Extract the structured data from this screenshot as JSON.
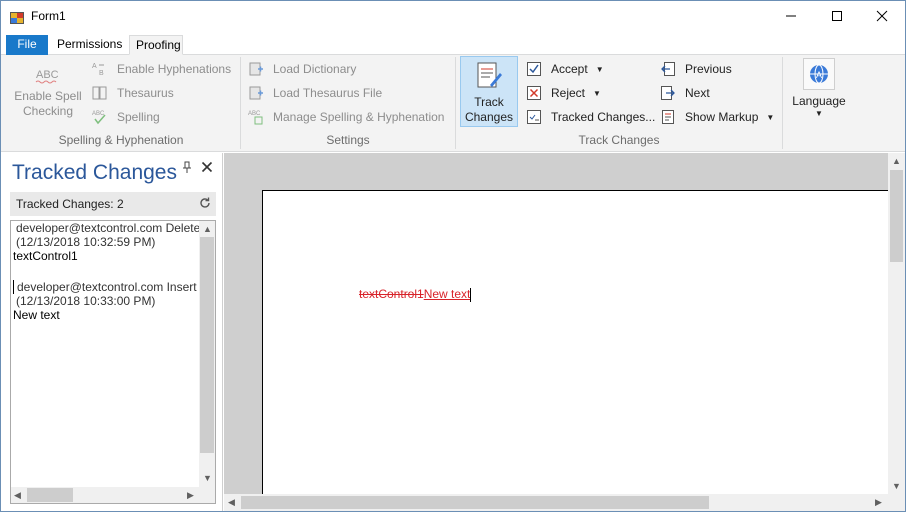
{
  "window": {
    "title": "Form1"
  },
  "ribbon_tabs": {
    "file": "File",
    "permissions": "Permissions",
    "proofing": "Proofing"
  },
  "spelling_group": {
    "enable_spell_line1": "Enable Spell",
    "enable_spell_line2": "Checking",
    "enable_hyphenations": "Enable Hyphenations",
    "thesaurus": "Thesaurus",
    "spelling": "Spelling",
    "label": "Spelling & Hyphenation"
  },
  "settings_group": {
    "load_dictionary": "Load Dictionary",
    "load_thesaurus": "Load Thesaurus File",
    "manage": "Manage Spelling & Hyphenation",
    "label": "Settings"
  },
  "track_group": {
    "track_line1": "Track",
    "track_line2": "Changes",
    "accept": "Accept",
    "reject": "Reject",
    "tracked_changes": "Tracked Changes...",
    "previous": "Previous",
    "next": "Next",
    "show_markup": "Show Markup",
    "label": "Track Changes"
  },
  "language_group": {
    "language": "Language"
  },
  "panel": {
    "title": "Tracked Changes",
    "count_label": "Tracked Changes: 2",
    "entries": [
      {
        "header": "developer@textcontrol.com Delete",
        "time": "(12/13/2018 10:32:59 PM)",
        "text": "textControl1"
      },
      {
        "header": "developer@textcontrol.com Insert",
        "time": "(12/13/2018 10:33:00 PM)",
        "text": "New text"
      }
    ]
  },
  "document": {
    "deleted_text": "textControl1",
    "inserted_text": "New text"
  },
  "colors": {
    "accent": "#1979ca",
    "panel_title": "#2b579a",
    "change_red": "#d8232a"
  }
}
